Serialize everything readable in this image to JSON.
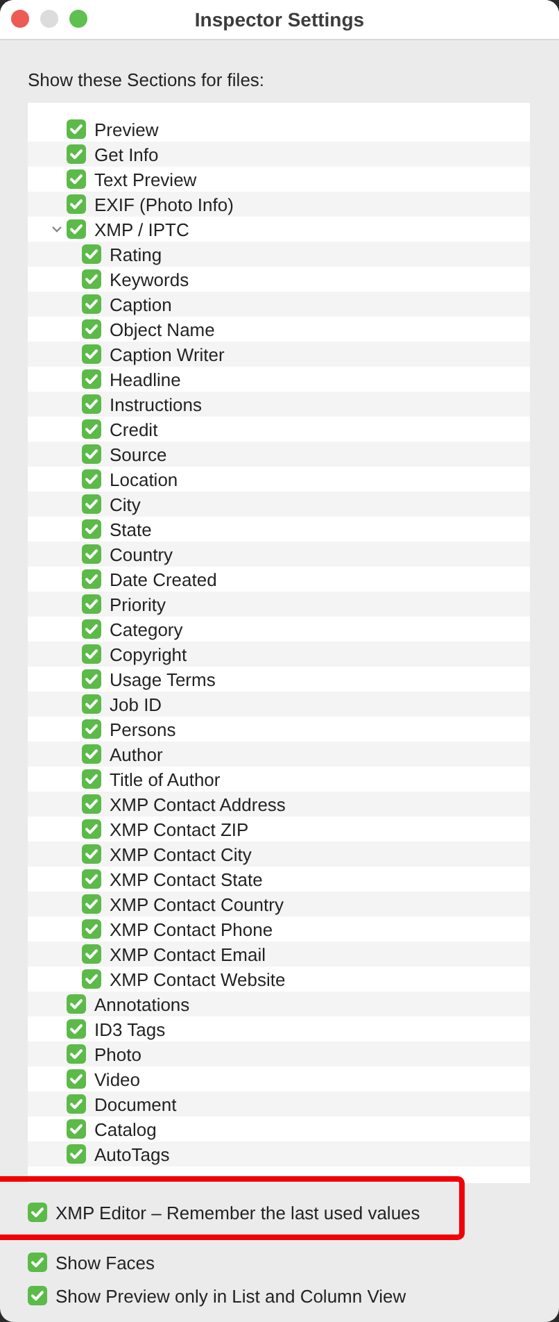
{
  "window": {
    "title": "Inspector Settings"
  },
  "heading": "Show these Sections for files:",
  "sections": [
    {
      "label": "Preview",
      "checked": true
    },
    {
      "label": "Get Info",
      "checked": true
    },
    {
      "label": "Text Preview",
      "checked": true
    },
    {
      "label": "EXIF (Photo Info)",
      "checked": true
    },
    {
      "label": "XMP / IPTC",
      "checked": true,
      "expanded": true,
      "children": [
        {
          "label": "Rating",
          "checked": true
        },
        {
          "label": "Keywords",
          "checked": true
        },
        {
          "label": "Caption",
          "checked": true
        },
        {
          "label": "Object Name",
          "checked": true
        },
        {
          "label": "Caption Writer",
          "checked": true
        },
        {
          "label": "Headline",
          "checked": true
        },
        {
          "label": "Instructions",
          "checked": true
        },
        {
          "label": "Credit",
          "checked": true
        },
        {
          "label": "Source",
          "checked": true
        },
        {
          "label": "Location",
          "checked": true
        },
        {
          "label": "City",
          "checked": true
        },
        {
          "label": "State",
          "checked": true
        },
        {
          "label": "Country",
          "checked": true
        },
        {
          "label": "Date Created",
          "checked": true
        },
        {
          "label": "Priority",
          "checked": true
        },
        {
          "label": "Category",
          "checked": true
        },
        {
          "label": "Copyright",
          "checked": true
        },
        {
          "label": "Usage Terms",
          "checked": true
        },
        {
          "label": "Job ID",
          "checked": true
        },
        {
          "label": "Persons",
          "checked": true
        },
        {
          "label": "Author",
          "checked": true
        },
        {
          "label": "Title of Author",
          "checked": true
        },
        {
          "label": "XMP Contact Address",
          "checked": true
        },
        {
          "label": "XMP Contact ZIP",
          "checked": true
        },
        {
          "label": "XMP Contact City",
          "checked": true
        },
        {
          "label": "XMP Contact State",
          "checked": true
        },
        {
          "label": "XMP Contact Country",
          "checked": true
        },
        {
          "label": "XMP Contact Phone",
          "checked": true
        },
        {
          "label": "XMP Contact Email",
          "checked": true
        },
        {
          "label": "XMP Contact Website",
          "checked": true
        }
      ]
    },
    {
      "label": "Annotations",
      "checked": true
    },
    {
      "label": "ID3 Tags",
      "checked": true
    },
    {
      "label": "Photo",
      "checked": true
    },
    {
      "label": "Video",
      "checked": true
    },
    {
      "label": "Document",
      "checked": true
    },
    {
      "label": "Catalog",
      "checked": true
    },
    {
      "label": "AutoTags",
      "checked": true
    }
  ],
  "options": [
    {
      "label": "XMP Editor – Remember the last used values",
      "checked": true,
      "highlighted": true
    },
    {
      "label": "Show Faces",
      "checked": true,
      "highlighted": false
    },
    {
      "label": "Show Preview only in List and Column View",
      "checked": true,
      "highlighted": false
    }
  ]
}
